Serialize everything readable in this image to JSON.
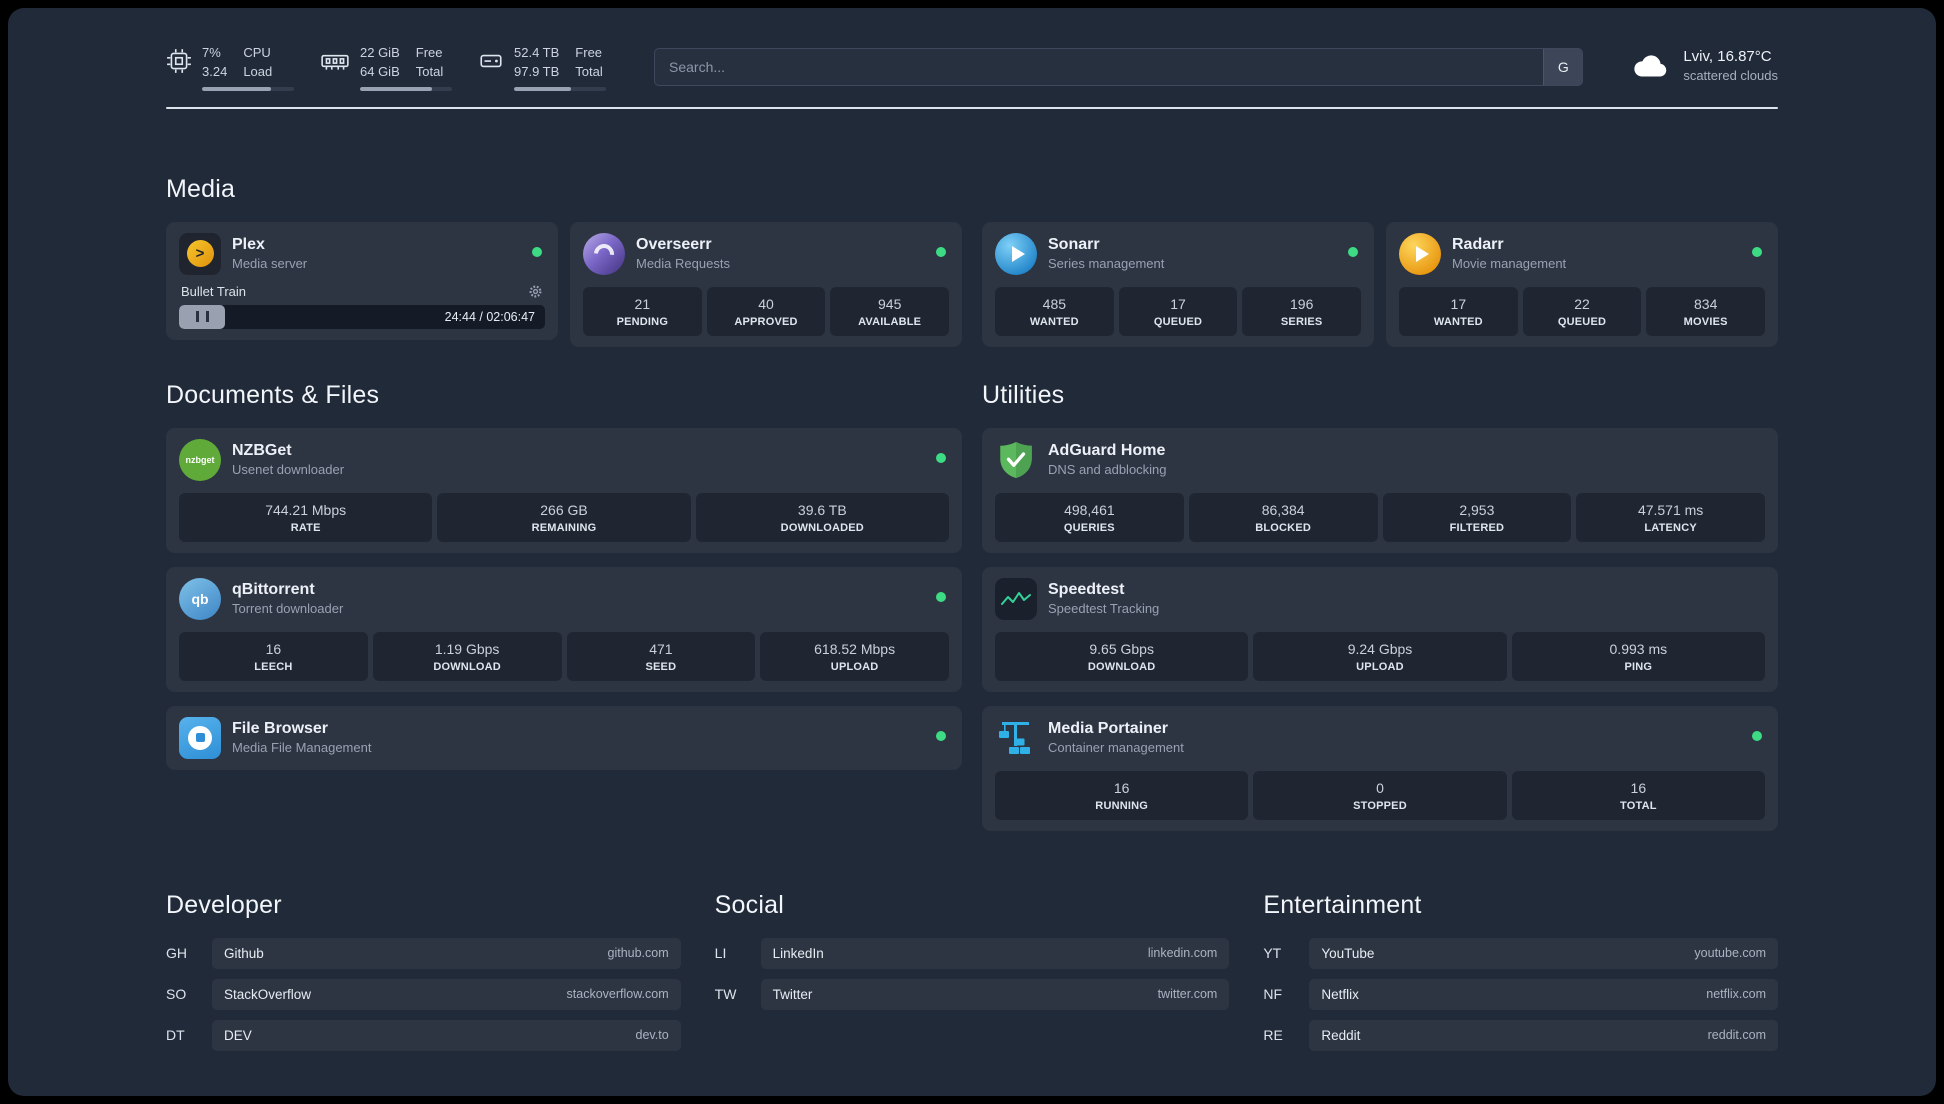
{
  "colors": {
    "background": "#212a39",
    "status_online": "#3ddc84",
    "plex_gold": "#e5a00d",
    "overseerr_purple": "#7b68c8",
    "sonarr_blue": "#2285c9",
    "radarr_gold": "#e8960f",
    "nzbget_green": "#5faa38",
    "qbittorrent_blue": "#3e86c6",
    "adguard_green": "#5cb85c",
    "speedtest_green": "#34d399",
    "filebrowser_blue": "#2f8fd6",
    "portainer_blue": "#2fb1e8"
  },
  "topbar": {
    "cpu": {
      "value": "7%",
      "sub": "3.24",
      "label1": "CPU",
      "label2": "Load"
    },
    "memory": {
      "value": "22 GiB",
      "sub": "64 GiB",
      "label1": "Free",
      "label2": "Total"
    },
    "disk": {
      "value": "52.4 TB",
      "sub": "97.9 TB",
      "label1": "Free",
      "label2": "Total"
    },
    "search": {
      "placeholder": "Search...",
      "provider": "G"
    },
    "weather": {
      "location": "Lviv, 16.87°C",
      "condition": "scattered clouds"
    }
  },
  "sections": {
    "media": {
      "title": "Media",
      "cards": [
        {
          "name": "Plex",
          "desc": "Media server",
          "player": {
            "title": "Bullet Train",
            "time": "24:44 / 02:06:47"
          }
        },
        {
          "name": "Overseerr",
          "desc": "Media Requests",
          "stats": [
            {
              "value": "21",
              "label": "PENDING"
            },
            {
              "value": "40",
              "label": "APPROVED"
            },
            {
              "value": "945",
              "label": "AVAILABLE"
            }
          ]
        },
        {
          "name": "Sonarr",
          "desc": "Series management",
          "stats": [
            {
              "value": "485",
              "label": "WANTED"
            },
            {
              "value": "17",
              "label": "QUEUED"
            },
            {
              "value": "196",
              "label": "SERIES"
            }
          ]
        },
        {
          "name": "Radarr",
          "desc": "Movie management",
          "stats": [
            {
              "value": "17",
              "label": "WANTED"
            },
            {
              "value": "22",
              "label": "QUEUED"
            },
            {
              "value": "834",
              "label": "MOVIES"
            }
          ]
        }
      ]
    },
    "documents": {
      "title": "Documents & Files",
      "cards": [
        {
          "name": "NZBGet",
          "desc": "Usenet downloader",
          "icon_text": "nzbget",
          "stats": [
            {
              "value": "744.21 Mbps",
              "label": "RATE"
            },
            {
              "value": "266 GB",
              "label": "REMAINING"
            },
            {
              "value": "39.6 TB",
              "label": "DOWNLOADED"
            }
          ]
        },
        {
          "name": "qBittorrent",
          "desc": "Torrent downloader",
          "icon_text": "qb",
          "stats": [
            {
              "value": "16",
              "label": "LEECH"
            },
            {
              "value": "1.19 Gbps",
              "label": "DOWNLOAD"
            },
            {
              "value": "471",
              "label": "SEED"
            },
            {
              "value": "618.52 Mbps",
              "label": "UPLOAD"
            }
          ]
        },
        {
          "name": "File Browser",
          "desc": "Media File Management"
        }
      ]
    },
    "utilities": {
      "title": "Utilities",
      "cards": [
        {
          "name": "AdGuard Home",
          "desc": "DNS and adblocking",
          "stats": [
            {
              "value": "498,461",
              "label": "QUERIES"
            },
            {
              "value": "86,384",
              "label": "BLOCKED"
            },
            {
              "value": "2,953",
              "label": "FILTERED"
            },
            {
              "value": "47.571 ms",
              "label": "LATENCY"
            }
          ]
        },
        {
          "name": "Speedtest",
          "desc": "Speedtest Tracking",
          "stats": [
            {
              "value": "9.65 Gbps",
              "label": "DOWNLOAD"
            },
            {
              "value": "9.24 Gbps",
              "label": "UPLOAD"
            },
            {
              "value": "0.993 ms",
              "label": "PING"
            }
          ]
        },
        {
          "name": "Media Portainer",
          "desc": "Container management",
          "stats": [
            {
              "value": "16",
              "label": "RUNNING"
            },
            {
              "value": "0",
              "label": "STOPPED"
            },
            {
              "value": "16",
              "label": "TOTAL"
            }
          ]
        }
      ]
    }
  },
  "bookmarks": [
    {
      "title": "Developer",
      "items": [
        {
          "abbr": "GH",
          "name": "Github",
          "domain": "github.com"
        },
        {
          "abbr": "SO",
          "name": "StackOverflow",
          "domain": "stackoverflow.com"
        },
        {
          "abbr": "DT",
          "name": "DEV",
          "domain": "dev.to"
        }
      ]
    },
    {
      "title": "Social",
      "items": [
        {
          "abbr": "LI",
          "name": "LinkedIn",
          "domain": "linkedin.com"
        },
        {
          "abbr": "TW",
          "name": "Twitter",
          "domain": "twitter.com"
        }
      ]
    },
    {
      "title": "Entertainment",
      "items": [
        {
          "abbr": "YT",
          "name": "YouTube",
          "domain": "youtube.com"
        },
        {
          "abbr": "NF",
          "name": "Netflix",
          "domain": "netflix.com"
        },
        {
          "abbr": "RE",
          "name": "Reddit",
          "domain": "reddit.com"
        }
      ]
    }
  ]
}
